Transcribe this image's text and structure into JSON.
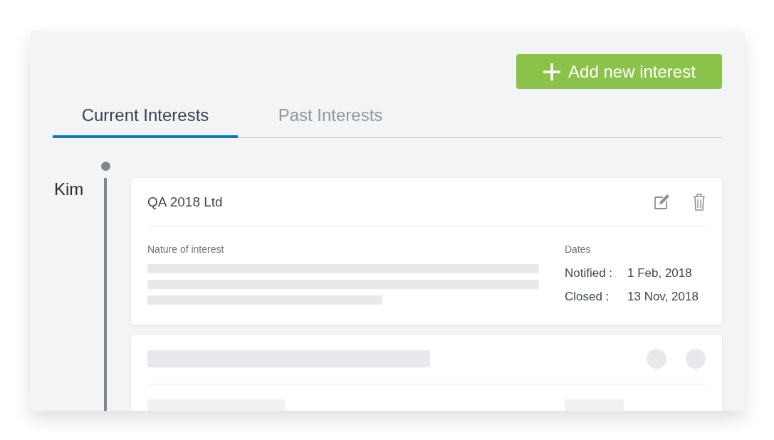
{
  "add_button": {
    "label": "Add new interest"
  },
  "tabs": [
    {
      "label": "Current Interests",
      "selected": true
    },
    {
      "label": "Past Interests",
      "selected": false
    }
  ],
  "groups": [
    {
      "name": "Kim",
      "interests": [
        {
          "kind": "loaded",
          "title": "QA 2018 Ltd",
          "nature_label": "Nature of interest",
          "dates_label": "Dates",
          "dates": [
            {
              "label": "Notified :",
              "value": "1 Feb, 2018"
            },
            {
              "label": "Closed :",
              "value": "13 Nov, 2018"
            }
          ]
        },
        {
          "kind": "skeleton"
        }
      ]
    }
  ]
}
